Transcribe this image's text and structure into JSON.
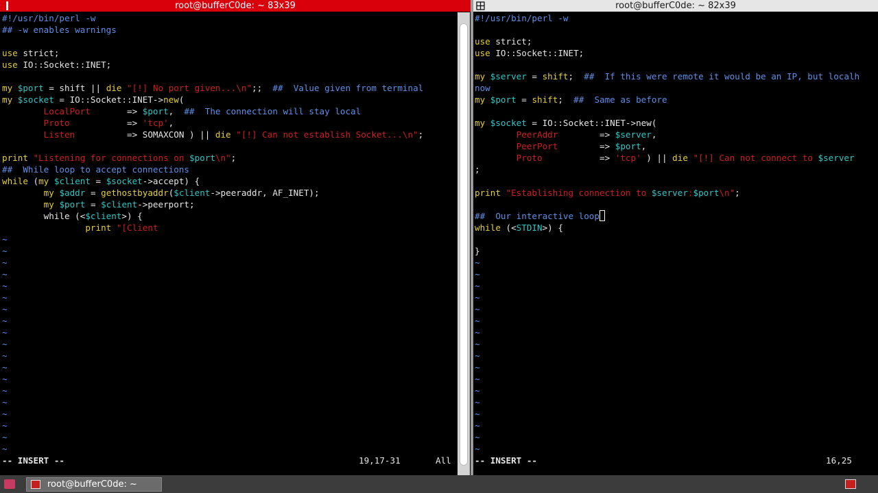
{
  "left_window": {
    "title": "root@bufferC0de: ~ 83x39",
    "code": [
      [
        [
          "#!/usr/bin/perl -w",
          "cm"
        ]
      ],
      [
        [
          "## -w enables warnings",
          "cm"
        ]
      ],
      [],
      [
        [
          "use",
          "kw"
        ],
        [
          " strict;",
          ""
        ]
      ],
      [
        [
          "use",
          "kw"
        ],
        [
          " IO::Socket::INET;",
          ""
        ]
      ],
      [],
      [
        [
          "my",
          "kw"
        ],
        [
          " ",
          ""
        ],
        [
          "$port",
          "var"
        ],
        [
          " = shift || ",
          ""
        ],
        [
          "die",
          "kw"
        ],
        [
          " ",
          ""
        ],
        [
          "\"[!] No port given...\\n\"",
          "str"
        ],
        [
          ";;  ",
          ""
        ],
        [
          "##  Value given from terminal",
          "cm"
        ]
      ],
      [
        [
          "my",
          "kw"
        ],
        [
          " ",
          ""
        ],
        [
          "$socket",
          "var"
        ],
        [
          " = IO::Socket::INET->",
          ""
        ],
        [
          "new",
          "kw"
        ],
        [
          "(",
          ""
        ]
      ],
      [
        [
          "        ",
          ""
        ],
        [
          "LocalPort",
          "key"
        ],
        [
          "       => ",
          ""
        ],
        [
          "$port",
          "var"
        ],
        [
          ",  ",
          ""
        ],
        [
          "##  The connection will stay local",
          "cm"
        ]
      ],
      [
        [
          "        ",
          ""
        ],
        [
          "Proto",
          "key"
        ],
        [
          "           => ",
          ""
        ],
        [
          "'tcp'",
          "str"
        ],
        [
          ",",
          ""
        ]
      ],
      [
        [
          "        ",
          ""
        ],
        [
          "Listen",
          "key"
        ],
        [
          "          => SOMAXCON ) || ",
          ""
        ],
        [
          "die",
          "kw"
        ],
        [
          " ",
          ""
        ],
        [
          "\"[!] Can not establish Socket...\\n\"",
          "str"
        ],
        [
          ";",
          ""
        ]
      ],
      [],
      [
        [
          "print",
          "kw"
        ],
        [
          " ",
          ""
        ],
        [
          "\"Listening for connections on ",
          "str"
        ],
        [
          "$port",
          "var"
        ],
        [
          "\\n\"",
          "str"
        ],
        [
          ";",
          ""
        ]
      ],
      [
        [
          "##  While loop to accept connections",
          "cm"
        ]
      ],
      [
        [
          "while",
          "kw"
        ],
        [
          " (",
          ""
        ],
        [
          "my",
          "kw"
        ],
        [
          " ",
          ""
        ],
        [
          "$client",
          "var"
        ],
        [
          " = ",
          ""
        ],
        [
          "$socket",
          "var"
        ],
        [
          "->accept) {",
          ""
        ]
      ],
      [
        [
          "        ",
          ""
        ],
        [
          "my",
          "kw"
        ],
        [
          " ",
          ""
        ],
        [
          "$addr",
          "var"
        ],
        [
          " = ",
          ""
        ],
        [
          "gethostbyaddr",
          "kw"
        ],
        [
          "(",
          ""
        ],
        [
          "$client",
          "var"
        ],
        [
          "->peeraddr, AF_INET);",
          ""
        ]
      ],
      [
        [
          "        ",
          ""
        ],
        [
          "my",
          "kw"
        ],
        [
          " ",
          ""
        ],
        [
          "$port",
          "var"
        ],
        [
          " = ",
          ""
        ],
        [
          "$client",
          "var"
        ],
        [
          "->peerport;",
          ""
        ]
      ],
      [
        [
          "        while (<",
          ""
        ],
        [
          "$client",
          "var"
        ],
        [
          ">) {",
          ""
        ]
      ],
      [
        [
          "                ",
          ""
        ],
        [
          "print",
          "kw"
        ],
        [
          " ",
          ""
        ],
        [
          "\"[Client",
          "str"
        ]
      ]
    ],
    "tilde_count": 19,
    "status_mode": "-- INSERT --",
    "status_position": "19,17-31",
    "status_scroll": "All"
  },
  "right_window": {
    "title": "root@bufferC0de: ~ 82x39",
    "code": [
      [
        [
          "#!/usr/bin/perl -w",
          "cm"
        ]
      ],
      [],
      [
        [
          "use",
          "kw"
        ],
        [
          " strict;",
          ""
        ]
      ],
      [
        [
          "use",
          "kw"
        ],
        [
          " IO::Socket::INET;",
          ""
        ]
      ],
      [],
      [
        [
          "my",
          "kw"
        ],
        [
          " ",
          ""
        ],
        [
          "$server",
          "var"
        ],
        [
          " = ",
          ""
        ],
        [
          "shift",
          "kw"
        ],
        [
          ";  ",
          ""
        ],
        [
          "##  If this were remote it would be an IP, but localh",
          "cm"
        ]
      ],
      [
        [
          "now",
          "cm"
        ]
      ],
      [
        [
          "my",
          "kw"
        ],
        [
          " ",
          ""
        ],
        [
          "$port",
          "var"
        ],
        [
          " = ",
          ""
        ],
        [
          "shift",
          "kw"
        ],
        [
          ";  ",
          ""
        ],
        [
          "##  Same as before",
          "cm"
        ]
      ],
      [],
      [
        [
          "my",
          "kw"
        ],
        [
          " ",
          ""
        ],
        [
          "$socket",
          "var"
        ],
        [
          " = IO::Socket::INET->new(",
          ""
        ]
      ],
      [
        [
          "        ",
          ""
        ],
        [
          "PeerAddr",
          "key"
        ],
        [
          "        => ",
          ""
        ],
        [
          "$server",
          "var"
        ],
        [
          ",",
          ""
        ]
      ],
      [
        [
          "        ",
          ""
        ],
        [
          "PeerPort",
          "key"
        ],
        [
          "        => ",
          ""
        ],
        [
          "$port",
          "var"
        ],
        [
          ",",
          ""
        ]
      ],
      [
        [
          "        ",
          ""
        ],
        [
          "Proto",
          "key"
        ],
        [
          "           => ",
          ""
        ],
        [
          "'tcp'",
          "str"
        ],
        [
          " ) || ",
          ""
        ],
        [
          "die",
          "kw"
        ],
        [
          " ",
          ""
        ],
        [
          "\"[!] Can not connect to ",
          "str"
        ],
        [
          "$server",
          "var"
        ]
      ],
      [
        [
          ";",
          ""
        ]
      ],
      [],
      [
        [
          "print",
          "kw"
        ],
        [
          " ",
          ""
        ],
        [
          "\"Establishing connection to ",
          "str"
        ],
        [
          "$server",
          "var"
        ],
        [
          ":",
          "str"
        ],
        [
          "$port",
          "var"
        ],
        [
          "\\n\"",
          "str"
        ],
        [
          ";",
          ""
        ]
      ],
      [],
      [
        [
          "##  Our interactive loop",
          "cm"
        ],
        [
          "CURSOR",
          ""
        ]
      ],
      [
        [
          "while",
          "kw"
        ],
        [
          " (<",
          ""
        ],
        [
          "STDIN",
          "var"
        ],
        [
          ">) {",
          ""
        ]
      ],
      [],
      [
        [
          "}",
          ""
        ]
      ]
    ],
    "tilde_count": 17,
    "status_mode": "-- INSERT --",
    "status_position": "16,25"
  },
  "taskbar": {
    "task_label": "root@bufferC0de: ~"
  },
  "icons": {
    "left_title_icon": "terminal-icon",
    "right_title_icon": "move-icon",
    "menu_icon": "app-menu-icon",
    "task_icon": "terminal-icon",
    "tray_icon": "terminal-icon"
  },
  "colors": {
    "left_titlebar": "#d9000c",
    "right_titlebar": "#e6e6e6",
    "comment": "#5f8fe8",
    "keyword": "#e6cf3a",
    "variable": "#2ec7c7",
    "string": "#d01e1e"
  }
}
